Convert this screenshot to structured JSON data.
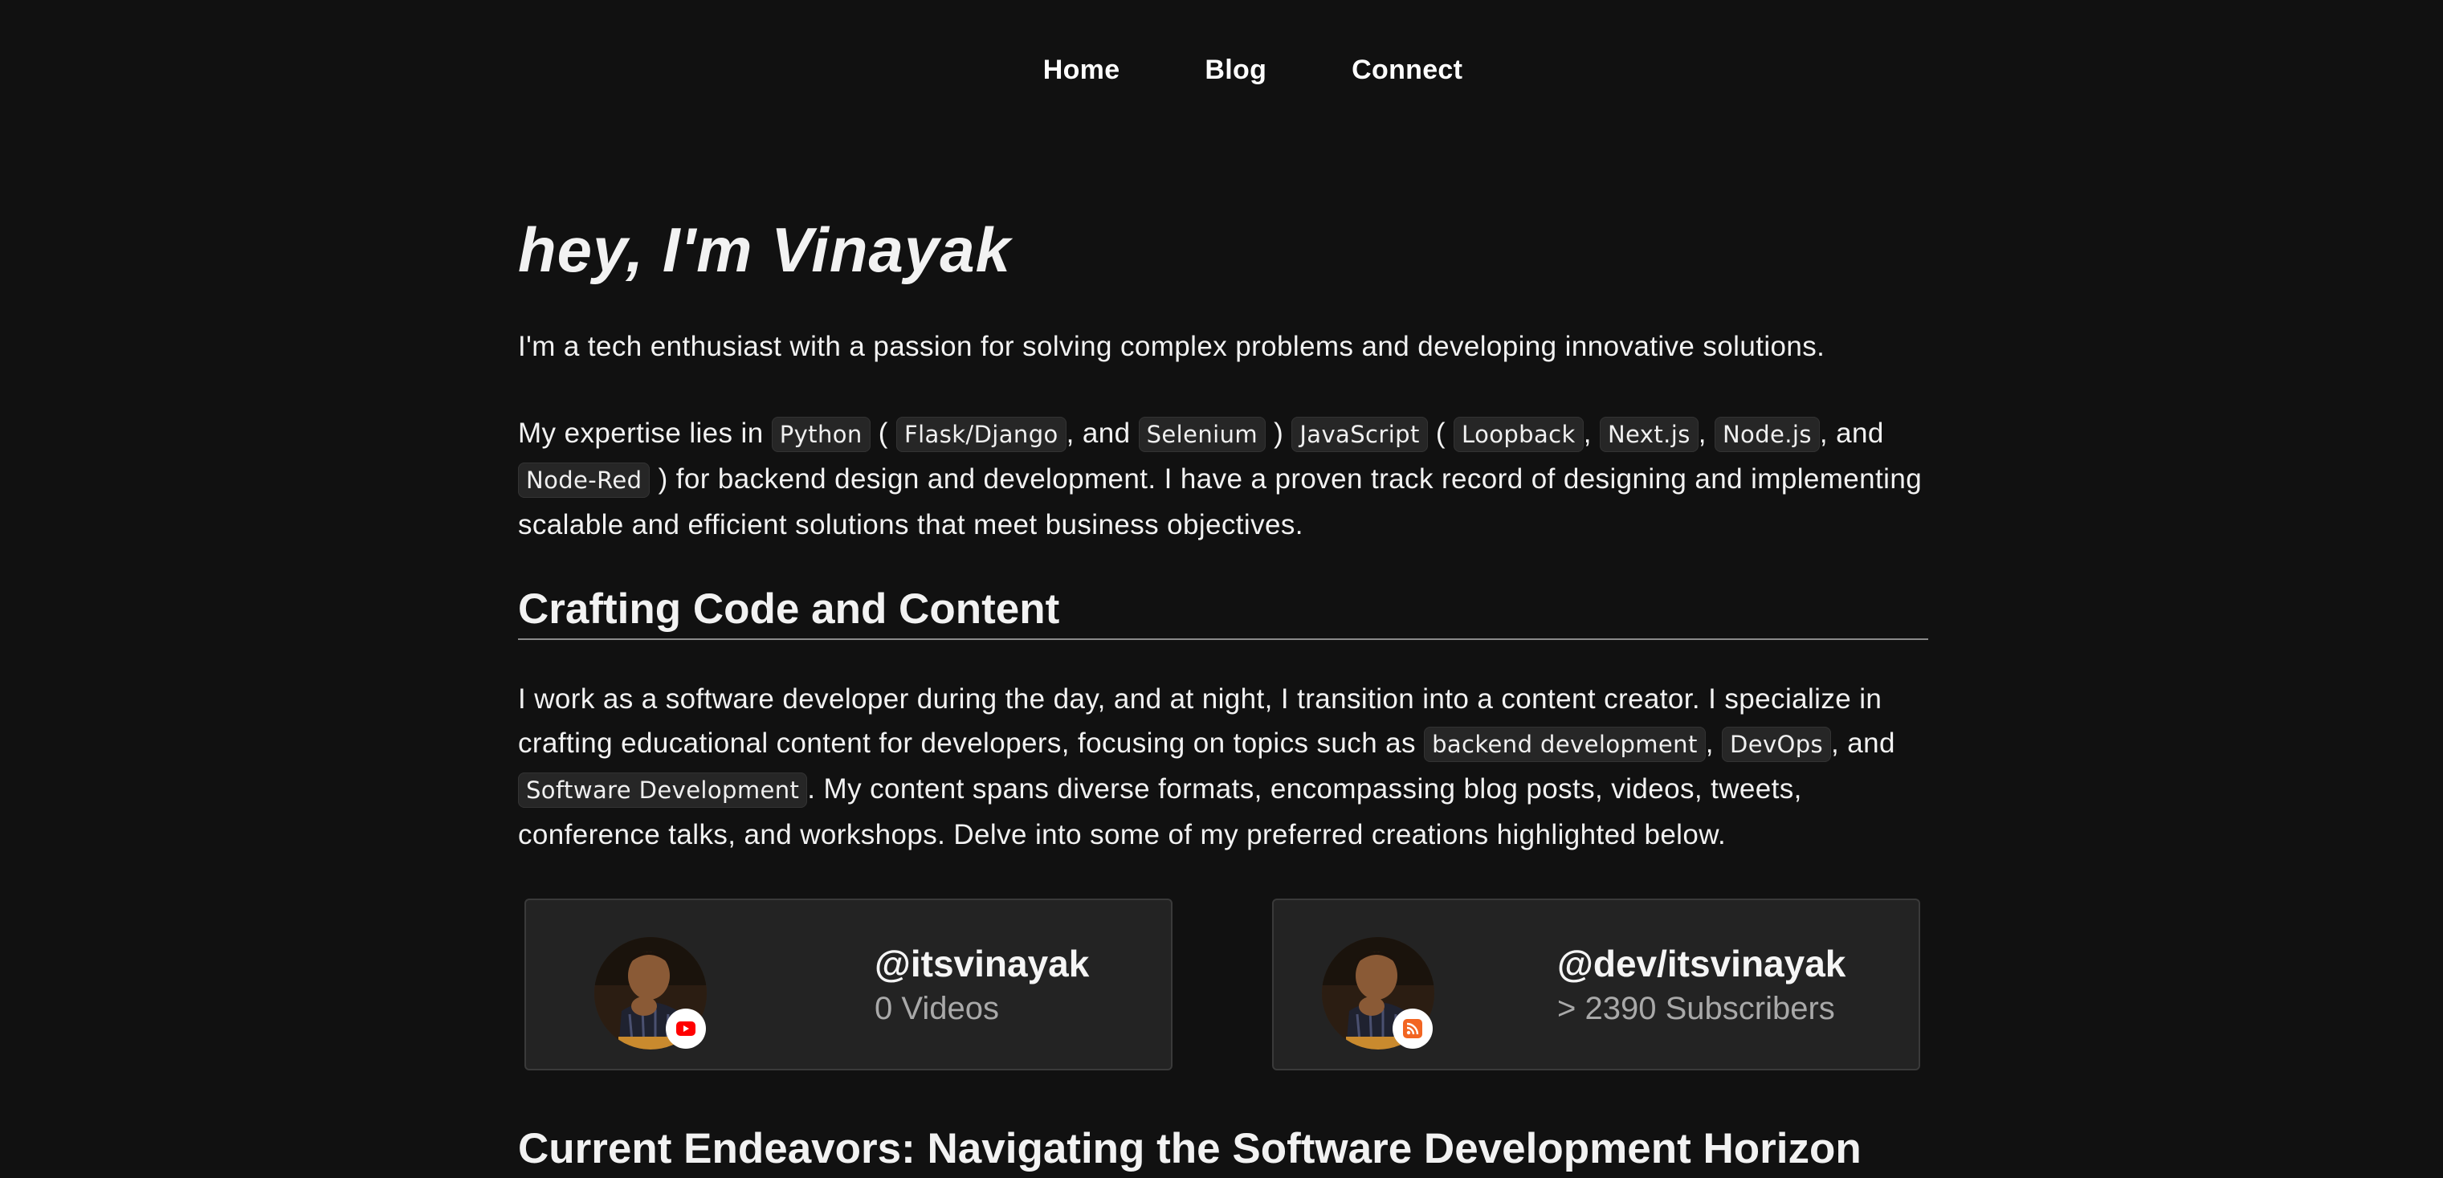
{
  "nav": {
    "home": "Home",
    "blog": "Blog",
    "connect": "Connect"
  },
  "hero": {
    "title": "hey, I'm Vinayak"
  },
  "intro": "I'm a tech enthusiast with a passion for solving complex problems and developing innovative solutions.",
  "expertise": {
    "t1": "My expertise lies in ",
    "python": "Python",
    "t2": " ( ",
    "flask": "Flask/Django",
    "t3": ", and ",
    "selenium": "Selenium",
    "t4": " ) ",
    "javascript": "JavaScript",
    "t5": " ( ",
    "loopback": "Loopback",
    "t6": ", ",
    "nextjs": "Next.js",
    "t7": ", ",
    "nodejs": "Node.js",
    "t8": ", and ",
    "nodered": "Node-Red",
    "t9": " ) for backend design and development. I have a proven track record of designing and implementing scalable and efficient solutions that meet business objectives."
  },
  "section1": {
    "title": "Crafting Code and Content"
  },
  "crafting": {
    "t1": "I work as a software developer during the day, and at night, I transition into a content creator. I specialize in crafting educational content for developers, focusing on topics such as ",
    "backend": "backend development",
    "t2": ", ",
    "devops": "DevOps",
    "t3": ", and ",
    "softdev": "Software Development",
    "t4": ". My content spans diverse formats, encompassing blog posts, videos, tweets, conference talks, and workshops. Delve into some of my preferred creations highlighted below."
  },
  "cards": [
    {
      "handle": "@itsvinayak",
      "stat": "0 Videos",
      "badge_icon": "youtube-icon",
      "badge_color": "#ff0000"
    },
    {
      "handle": "@dev/itsvinayak",
      "stat": "> 2390 Subscribers",
      "badge_icon": "rss-icon",
      "badge_color": "#f26522"
    }
  ],
  "section2": {
    "title": "Current Endeavors: Navigating the Software Development Horizon"
  }
}
